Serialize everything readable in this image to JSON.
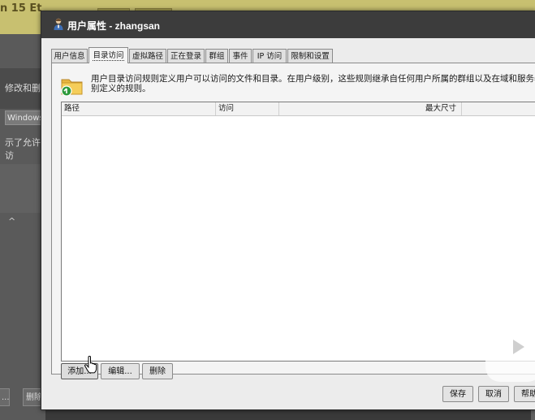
{
  "background": {
    "title_fragment": "n 15 Et",
    "left_text1": "修改和删",
    "left_chip": "Windows",
    "left_text2": "示了允许访",
    "left_caret": "^",
    "foot_btn1": "...",
    "foot_btn2": "删除"
  },
  "dialog": {
    "title": "用户属性 - zhangsan",
    "tabs": [
      "用户信息",
      "目录访问",
      "虚拟路径",
      "正在登录",
      "群组",
      "事件",
      "IP 访问",
      "限制和设置"
    ],
    "active_tab": "目录访问",
    "description_line1": "用户目录访问规则定义用户可以访问的文件和目录。在用户级别，这些规则继承自任何用户所属的群组以及在域和服务器",
    "description_line2": "别定义的规则。",
    "table": {
      "columns": [
        "路径",
        "访问",
        "最大尺寸"
      ],
      "rows": []
    },
    "buttons": {
      "add": "添加...",
      "edit": "编辑...",
      "delete": "删除",
      "save": "保存",
      "cancel": "取消",
      "help": "帮助"
    }
  },
  "colors": {
    "titlebar": "#3c3c3c",
    "dialog_bg": "#ececec",
    "background_top": "#c8c070"
  },
  "icons": [
    "user-icon",
    "folder-add-icon",
    "hand-cursor-icon",
    "video-watermark-icon"
  ]
}
